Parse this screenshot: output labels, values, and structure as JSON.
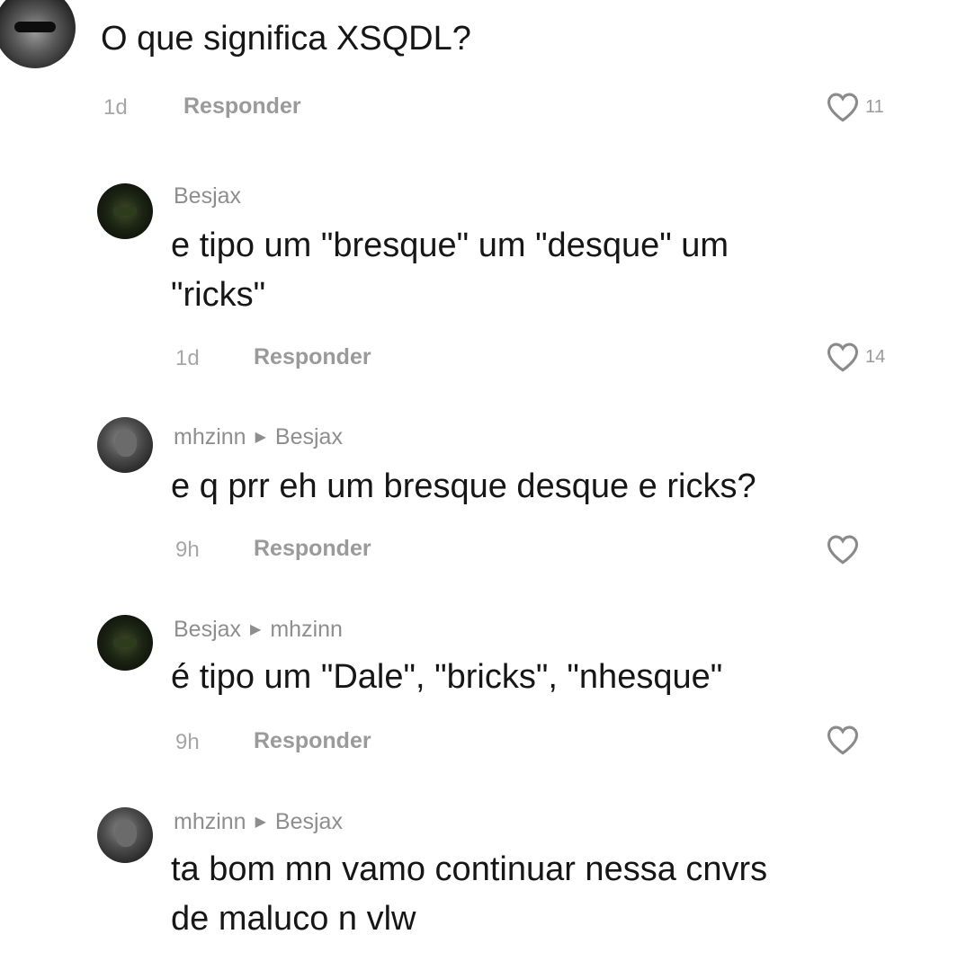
{
  "comments": [
    {
      "text": "O que significa XSQDL?",
      "time": "1d",
      "reply_label": "Responder",
      "likes": "11"
    },
    {
      "user": "Besjax",
      "text": "e tipo um \"bresque\" um \"desque\" um\n\"ricks\"",
      "time": "1d",
      "reply_label": "Responder",
      "likes": "14"
    },
    {
      "user": "mhzinn",
      "reply_to": "Besjax",
      "text": "e q prr eh um bresque desque e ricks?",
      "time": "9h",
      "reply_label": "Responder"
    },
    {
      "user": "Besjax",
      "reply_to": "mhzinn",
      "text": "é tipo um \"Dale\", \"bricks\", \"nhesque\"",
      "time": "9h",
      "reply_label": "Responder"
    },
    {
      "user": "mhzinn",
      "reply_to": "Besjax",
      "text": "ta bom mn vamo continuar nessa cnvrs\nde maluco n vlw"
    }
  ],
  "icons": {
    "like": "heart-outline-icon",
    "reply_arrow": "triangle-right-icon"
  },
  "colors": {
    "username": "#8e8e8e",
    "meta": "#9a9a9a",
    "text": "#161616"
  }
}
